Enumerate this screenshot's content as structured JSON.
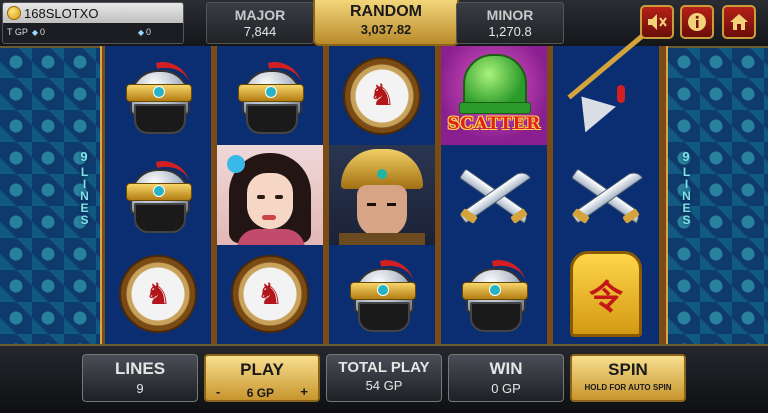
{
  "player": {
    "name": "168SLOTXO",
    "gp_label": "T GP",
    "gp_value": "0",
    "gem_value": "0"
  },
  "jackpots": {
    "major_label": "MAJOR",
    "major_value": "7,844",
    "random_label": "RANDOM",
    "random_value": "3,037.82",
    "minor_label": "MINOR",
    "minor_value": "1,270.8"
  },
  "side": {
    "lines_count": "9",
    "lines_word": "LINES"
  },
  "reels": [
    [
      "helmet",
      "helmet",
      "medal"
    ],
    [
      "helmet",
      "lady-portrait",
      "medal"
    ],
    [
      "medal",
      "warrior-portrait",
      "helmet"
    ],
    [
      "scatter",
      "swords",
      "helmet"
    ],
    [
      "halberd",
      "swords",
      "gold-token"
    ]
  ],
  "symbols": {
    "scatter_text": "SCATTER",
    "token_glyph": "令",
    "medal_glyph": "♞"
  },
  "controls": {
    "lines_label": "LINES",
    "lines_value": "9",
    "play_label": "PLAY",
    "play_minus": "-",
    "play_value": "6 GP",
    "play_plus": "+",
    "total_label": "TOTAL PLAY",
    "total_value": "54 GP",
    "win_label": "WIN",
    "win_value": "0 GP",
    "spin_label": "SPIN",
    "spin_sub": "HOLD FOR AUTO SPIN"
  },
  "icons": {
    "mute": "mute-icon",
    "info": "info-icon",
    "home": "home-icon"
  },
  "colors": {
    "gold": "#f3d67a",
    "reel_bg": "#0b2e73",
    "frame": "#7a4b14"
  }
}
